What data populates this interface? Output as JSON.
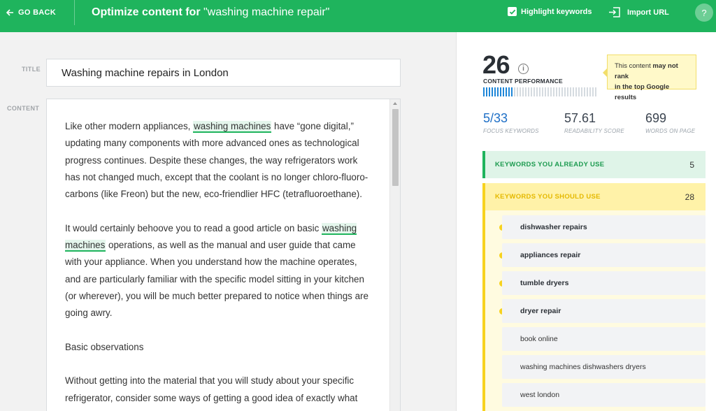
{
  "topbar": {
    "back_label": "GO BACK",
    "title_prefix": "Optimize content for ",
    "title_query": "\"washing machine repair\"",
    "highlight_label": "Highlight keywords",
    "highlight_checked": true,
    "import_label": "Import URL",
    "help_label": "?",
    "color": "#1fb45d"
  },
  "editor": {
    "title_label": "TITLE",
    "title_value": "Washing machine repairs in London",
    "content_label": "CONTENT",
    "paragraphs": [
      {
        "parts": [
          {
            "text": "Like other modern appliances, "
          },
          {
            "text": "washing machines",
            "keyword": true
          },
          {
            "text": " have “gone digital,” updating many components with more advanced ones as technological progress continues. Despite these changes, the way refrigerators work has not changed much, except that the coolant is no longer chloro-fluoro-carbons (like Freon) but the new, eco-friendlier HFC (tetrafluoroethane)."
          }
        ]
      },
      {
        "parts": [
          {
            "text": "It would certainly behoove you to read a good article on basic "
          },
          {
            "text": "washing machines",
            "keyword": true
          },
          {
            "text": " operations, as well as the manual and user guide that came with your appliance. When you understand how the machine operates, and are particularly familiar with the specific model sitting in your kitchen (or wherever), you will be much better prepared to notice when things are going awry."
          }
        ]
      },
      {
        "parts": [
          {
            "text": "Basic observations"
          }
        ]
      },
      {
        "parts": [
          {
            "text": "Without getting into the material that you will study about your specific refrigerator, consider some ways of getting a good idea of exactly what"
          }
        ]
      }
    ]
  },
  "panel": {
    "score": "26",
    "score_label": "CONTENT PERFORMANCE",
    "performance_fraction": 0.26,
    "info_icon": "i",
    "tooltip_pre": "This content ",
    "tooltip_bold": "may not rank",
    "tooltip_post": "in the top Google results",
    "stats": [
      {
        "value": "5/33",
        "label": "FOCUS KEYWORDS",
        "accent": true
      },
      {
        "value": "57.61",
        "label": "READABILITY SCORE",
        "accent": false
      },
      {
        "value": "699",
        "label": "WORDS ON PAGE",
        "accent": false
      }
    ],
    "used_title": "KEYWORDS YOU ALREADY USE",
    "used_count": "5",
    "should_title": "KEYWORDS YOU SHOULD USE",
    "should_count": "28",
    "keywords": [
      {
        "text": "dishwasher repairs",
        "important": true
      },
      {
        "text": "appliances repair",
        "important": true
      },
      {
        "text": "tumble dryers",
        "important": true
      },
      {
        "text": "dryer repair",
        "important": true
      },
      {
        "text": "book online",
        "important": false
      },
      {
        "text": "washing machines dishwashers dryers",
        "important": false
      },
      {
        "text": "west london",
        "important": false
      }
    ]
  }
}
